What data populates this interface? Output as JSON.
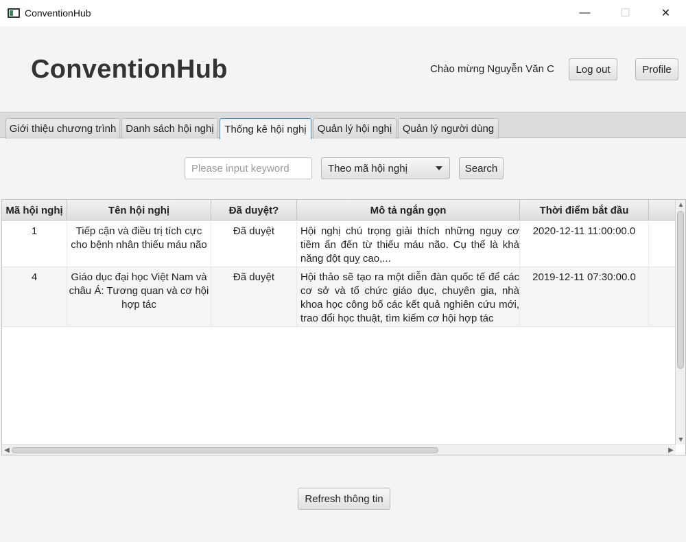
{
  "window": {
    "title": "ConventionHub",
    "minimize": "—",
    "maximize": "☐",
    "close": "✕"
  },
  "header": {
    "brand": "ConventionHub",
    "welcome": "Chào mừng Nguyễn Văn C",
    "logout_label": "Log out",
    "profile_label": "Profile"
  },
  "tabs": [
    {
      "label": "Giới thiệu chương trình"
    },
    {
      "label": "Danh sách hội nghị"
    },
    {
      "label": "Thống kê hội nghị"
    },
    {
      "label": "Quản lý hội nghị"
    },
    {
      "label": "Quản lý người dùng"
    }
  ],
  "active_tab": "Thống kê hội nghị",
  "search": {
    "placeholder": "Please input keyword",
    "value": "",
    "filter_selected": "Theo mã hội nghị",
    "button_label": "Search"
  },
  "table": {
    "columns": [
      "Mã hội nghị",
      "Tên hội nghị",
      "Đã duyệt?",
      "Mô tả ngắn gọn",
      "Thời điểm bắt đầu",
      ""
    ],
    "rows": [
      {
        "id": "1",
        "name": "Tiếp cận và điều trị tích cực cho bệnh nhân thiếu máu não",
        "approved": "Đã duyệt",
        "description": "Hội nghị chú trọng giải thích những nguy cơ tiềm ẩn đến từ thiếu máu não. Cụ thể là khả năng đột quỵ cao,...",
        "start_time": "2020-12-11 11:00:00.0"
      },
      {
        "id": "4",
        "name": "Giáo dục đại học Việt Nam và châu Á: Tương quan và cơ hội hợp tác",
        "approved": "Đã duyệt",
        "description": " Hội thảo sẽ tạo ra một diễn đàn quốc tế để các cơ sở và tổ chức giáo dục, chuyên gia, nhà khoa học công bố các kết quả nghiên cứu mới, trao đổi học thuật, tìm kiếm cơ hội hợp tác",
        "start_time": "2019-12-11 07:30:00.0"
      }
    ]
  },
  "footer": {
    "refresh_label": "Refresh thông tin"
  },
  "colors": {
    "background": "#f4f4f4",
    "active_tab_border": "#3c8fd6",
    "brand_text": "#333333"
  }
}
